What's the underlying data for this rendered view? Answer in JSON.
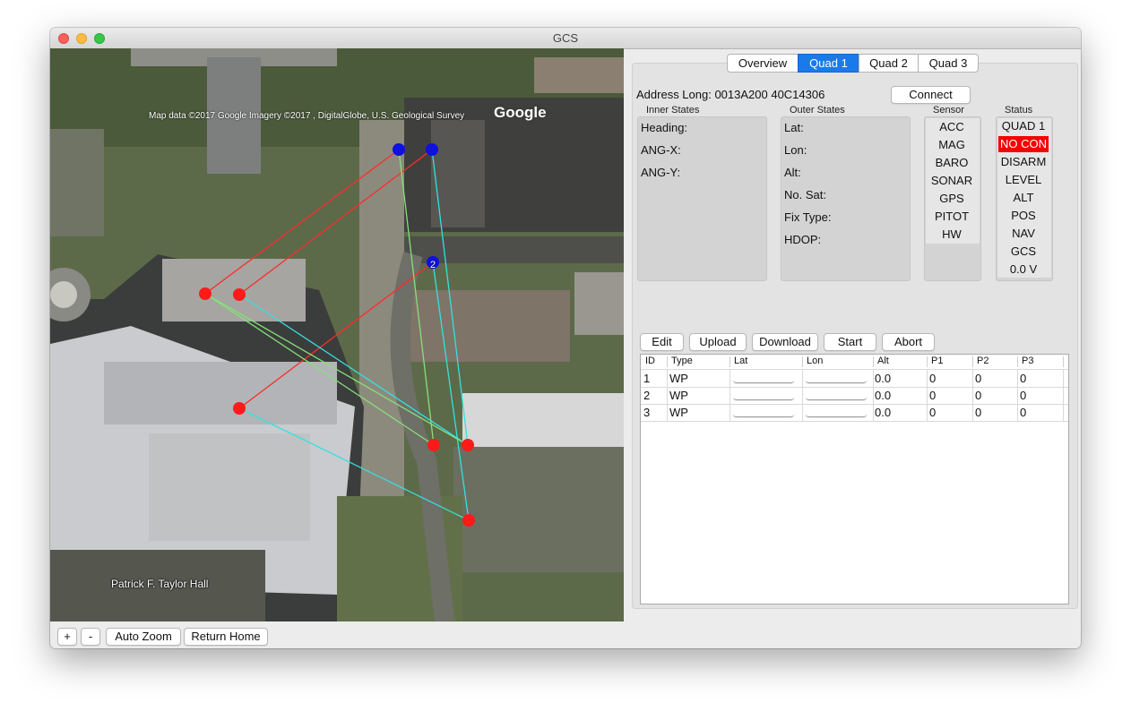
{
  "window": {
    "title": "GCS"
  },
  "map": {
    "attribution": "Map data ©2017 Google  Imagery ©2017 , DigitalGlobe, U.S. Geological Survey",
    "logo": "Google",
    "building_label": "Patrick F. Taylor Hall",
    "waypoint_number": "2",
    "controls": {
      "zoom_in": "+",
      "zoom_out": "-",
      "auto_zoom": "Auto Zoom",
      "return_home": "Return Home"
    }
  },
  "tabs": [
    {
      "label": "Overview",
      "active": false
    },
    {
      "label": "Quad 1",
      "active": true
    },
    {
      "label": "Quad 2",
      "active": false
    },
    {
      "label": "Quad 3",
      "active": false
    }
  ],
  "quad": {
    "address": "Address Long: 0013A200 40C14306",
    "connect_label": "Connect",
    "inner_states": {
      "title": "Inner States",
      "fields": [
        "Heading:",
        "ANG-X:",
        "ANG-Y:"
      ]
    },
    "outer_states": {
      "title": "Outer States",
      "fields": [
        "Lat:",
        "Lon:",
        "Alt:",
        "No. Sat:",
        "Fix Type:",
        "HDOP:"
      ]
    },
    "sensor": {
      "title": "Sensor",
      "items": [
        "ACC",
        "MAG",
        "BARO",
        "SONAR",
        "GPS",
        "PITOT",
        "HW"
      ]
    },
    "status": {
      "title": "Status",
      "items": [
        "QUAD 1",
        "NO CON",
        "DISARM",
        "LEVEL",
        "ALT",
        "POS",
        "NAV",
        "GCS",
        "0.0 V"
      ],
      "alert_color": "#f70000"
    }
  },
  "mission": {
    "buttons": [
      "Edit",
      "Upload",
      "Download",
      "Start",
      "Abort"
    ],
    "columns": [
      "ID",
      "Type",
      "Lat",
      "Lon",
      "Alt",
      "P1",
      "P2",
      "P3"
    ],
    "rows": [
      {
        "id": "1",
        "type": "WP",
        "alt": "0.0",
        "p1": "0",
        "p2": "0",
        "p3": "0"
      },
      {
        "id": "2",
        "type": "WP",
        "alt": "0.0",
        "p1": "0",
        "p2": "0",
        "p3": "0"
      },
      {
        "id": "3",
        "type": "WP",
        "alt": "0.0",
        "p1": "0",
        "p2": "0",
        "p3": "0"
      }
    ]
  },
  "colors": {
    "accent": "#1a7ae9",
    "waypoint_red": "#ff1a1a",
    "waypoint_blue": "#1010e0",
    "path_red": "#ff2a2a",
    "path_cyan": "#35e0e0",
    "path_green": "#86e07a"
  }
}
